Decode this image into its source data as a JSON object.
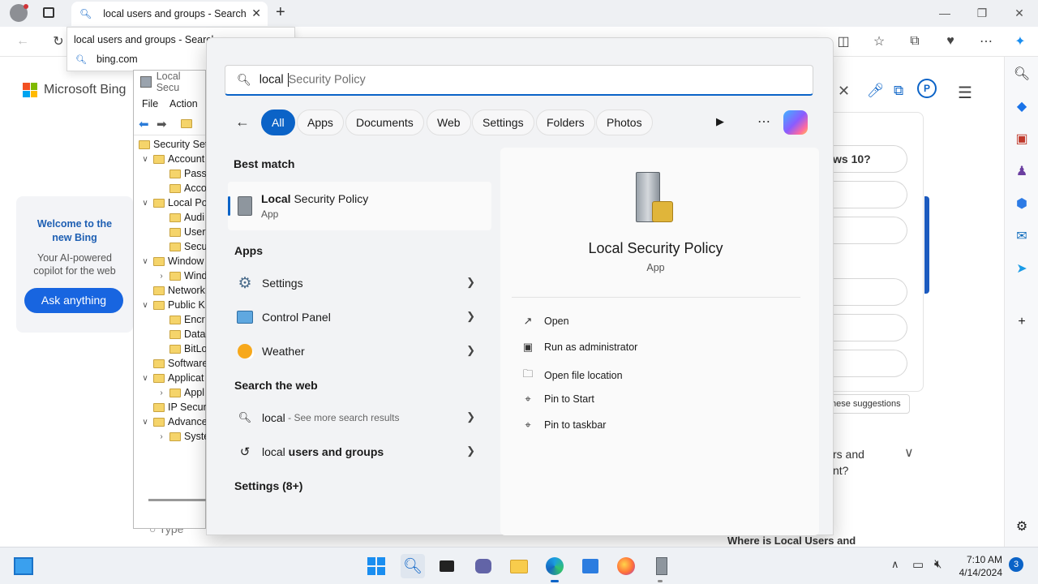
{
  "browser": {
    "tab_title": "local users and groups - Search",
    "address_popup": {
      "suggestion": "local users and groups - Search",
      "site": "bing.com"
    }
  },
  "bing": {
    "logo_text": "Microsoft Bing",
    "welcome_title": "Welcome to the new Bing",
    "welcome_sub": "Your AI-powered copilot for the web",
    "ask_button": "Ask anything",
    "right_question_fragment": "ws 10?",
    "suggestion_link_fragment": "hese suggestions",
    "faq_fragment_1": "rs and",
    "faq_fragment_2": "nt?",
    "bottom_fragment": "Where is Local Users and",
    "type_placeholder": "Type"
  },
  "mmc": {
    "title": "Local Secu",
    "menu": [
      "File",
      "Action"
    ],
    "tree": [
      {
        "label": "Security Set",
        "indent": 0,
        "chev": ""
      },
      {
        "label": "Account",
        "indent": 1,
        "chev": "v"
      },
      {
        "label": "Pass",
        "indent": 2,
        "chev": ""
      },
      {
        "label": "Acco",
        "indent": 2,
        "chev": ""
      },
      {
        "label": "Local Po",
        "indent": 1,
        "chev": "v"
      },
      {
        "label": "Audi",
        "indent": 2,
        "chev": ""
      },
      {
        "label": "User",
        "indent": 2,
        "chev": ""
      },
      {
        "label": "Secu",
        "indent": 2,
        "chev": ""
      },
      {
        "label": "Window",
        "indent": 1,
        "chev": "v"
      },
      {
        "label": "Wind",
        "indent": 2,
        "chev": ">"
      },
      {
        "label": "Network",
        "indent": 1,
        "chev": ""
      },
      {
        "label": "Public K",
        "indent": 1,
        "chev": "v"
      },
      {
        "label": "Encr",
        "indent": 2,
        "chev": ""
      },
      {
        "label": "Data",
        "indent": 2,
        "chev": ""
      },
      {
        "label": "BitLo",
        "indent": 2,
        "chev": ""
      },
      {
        "label": "Software",
        "indent": 1,
        "chev": ""
      },
      {
        "label": "Applicat",
        "indent": 1,
        "chev": "v"
      },
      {
        "label": "Appl",
        "indent": 2,
        "chev": ">"
      },
      {
        "label": "IP Secur",
        "indent": 1,
        "chev": ""
      },
      {
        "label": "Advance",
        "indent": 1,
        "chev": "v"
      },
      {
        "label": "Syste",
        "indent": 2,
        "chev": ">"
      }
    ]
  },
  "search": {
    "typed": "local ",
    "autocomplete": "Security Policy",
    "filters": [
      "All",
      "Apps",
      "Documents",
      "Web",
      "Settings",
      "Folders",
      "Photos"
    ],
    "best_match_heading": "Best match",
    "best_match": {
      "name_bold": "Local",
      "name_rest": " Security Policy",
      "type": "App"
    },
    "apps_heading": "Apps",
    "apps": [
      {
        "label": "Settings",
        "icon": "gear-icon"
      },
      {
        "label": "Control Panel",
        "icon": "control-panel-icon"
      },
      {
        "label": "Weather",
        "icon": "weather-icon"
      }
    ],
    "web_heading": "Search the web",
    "web": [
      {
        "main": "local",
        "sub": " - See more search results"
      },
      {
        "main": "local",
        "bold": " users and groups"
      }
    ],
    "settings_heading": "Settings (8+)",
    "detail": {
      "title": "Local Security Policy",
      "type": "App",
      "actions": [
        "Open",
        "Run as administrator",
        "Open file location",
        "Pin to Start",
        "Pin to taskbar"
      ]
    }
  },
  "taskbar": {
    "time": "7:10 AM",
    "date": "4/14/2024",
    "badge": "3"
  }
}
